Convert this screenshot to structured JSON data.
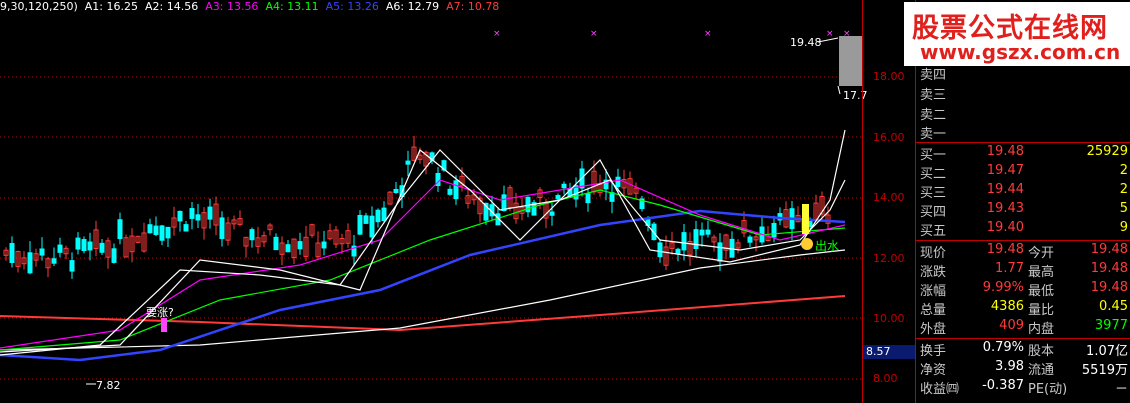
{
  "legend": {
    "params": "9,30,120,250)",
    "items": [
      {
        "label": "A1: 16.25",
        "color": "#ffffff"
      },
      {
        "label": "A2: 14.56",
        "color": "#ffffff"
      },
      {
        "label": "A3: 13.56",
        "color": "#ff00ff"
      },
      {
        "label": "A4: 13.11",
        "color": "#00ff00"
      },
      {
        "label": "A5: 13.26",
        "color": "#3344ff"
      },
      {
        "label": "A6: 12.79",
        "color": "#ffffff"
      },
      {
        "label": "A7: 10.78",
        "color": "#ff3a3a"
      }
    ]
  },
  "axis": {
    "ticks": [
      "18.00",
      "16.00",
      "14.00",
      "12.00",
      "10.00",
      "8.00"
    ],
    "current": "8.57"
  },
  "chart_annotations": {
    "high_label": "19.48",
    "bar_label": "17.7",
    "low_label": "7.82",
    "signal_left": "要涨?",
    "signal_right": "出水"
  },
  "watermark": {
    "title": "股票公式在线网",
    "url": "www.gszx.com.cn"
  },
  "order_book": {
    "sells": [
      {
        "label": "卖四"
      },
      {
        "label": "卖三"
      },
      {
        "label": "卖二"
      },
      {
        "label": "卖一"
      }
    ],
    "buys": [
      {
        "label": "买一",
        "price": "19.48",
        "vol": "25929"
      },
      {
        "label": "买二",
        "price": "19.47",
        "vol": "2"
      },
      {
        "label": "买三",
        "price": "19.44",
        "vol": "2"
      },
      {
        "label": "买四",
        "price": "19.43",
        "vol": "5"
      },
      {
        "label": "买五",
        "price": "19.40",
        "vol": "9"
      }
    ]
  },
  "quote": [
    {
      "l1": "现价",
      "v1": "19.48",
      "l2": "今开",
      "v2": "19.48"
    },
    {
      "l1": "涨跌",
      "v1": "1.77",
      "l2": "最高",
      "v2": "19.48"
    },
    {
      "l1": "涨幅",
      "v1": "9.99%",
      "l2": "最低",
      "v2": "19.48"
    },
    {
      "l1": "总量",
      "v1": "4386",
      "l2": "量比",
      "v2": "0.45"
    },
    {
      "l1": "外盘",
      "v1": "409",
      "l2": "内盘",
      "v2": "3977"
    }
  ],
  "fundamentals": [
    {
      "l1": "换手",
      "v1": "0.79%",
      "l2": "股本",
      "v2": "1.07亿"
    },
    {
      "l1": "净资",
      "v1": "3.98",
      "l2": "流通",
      "v2": "5519万"
    },
    {
      "l1": "收益㈣",
      "v1": "-0.387",
      "l2": "PE(动)",
      "v2": "－"
    }
  ],
  "colors": {
    "up": "#ff3a3a",
    "down": "#00ffff",
    "ma1": "#ffffff",
    "ma3": "#ff00ff",
    "ma4": "#00ff00",
    "ma5": "#3344ff",
    "ma7": "#ff3a3a",
    "grid": "#c00000"
  }
}
